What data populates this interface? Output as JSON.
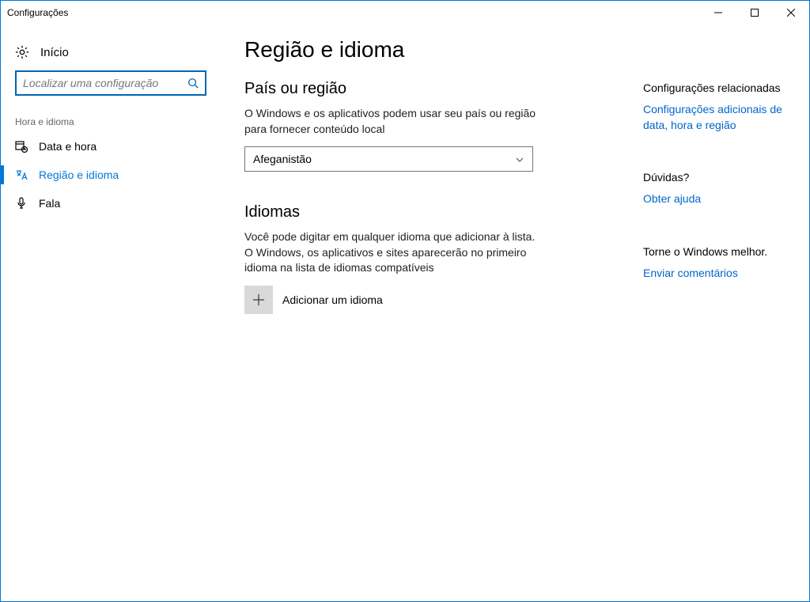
{
  "window": {
    "title": "Configurações"
  },
  "sidebar": {
    "home": "Início",
    "search_placeholder": "Localizar uma configuração",
    "group": "Hora e idioma",
    "items": [
      {
        "label": "Data e hora"
      },
      {
        "label": "Região e idioma"
      },
      {
        "label": "Fala"
      }
    ]
  },
  "main": {
    "title": "Região e idioma",
    "section_country": "País ou região",
    "country_desc": "O Windows e os aplicativos podem usar seu país ou região para fornecer conteúdo local",
    "country_value": "Afeganistão",
    "section_languages": "Idiomas",
    "languages_desc": "Você pode digitar em qualquer idioma que adicionar à lista. O Windows, os aplicativos e sites aparecerão no primeiro idioma na lista de idiomas compatíveis",
    "add_language": "Adicionar um idioma"
  },
  "rail": {
    "related_head": "Configurações relacionadas",
    "related_link": "Configurações adicionais de data, hora e região",
    "help_head": "Dúvidas?",
    "help_link": "Obter ajuda",
    "feedback_head": "Torne o Windows melhor.",
    "feedback_link": "Enviar comentários"
  }
}
